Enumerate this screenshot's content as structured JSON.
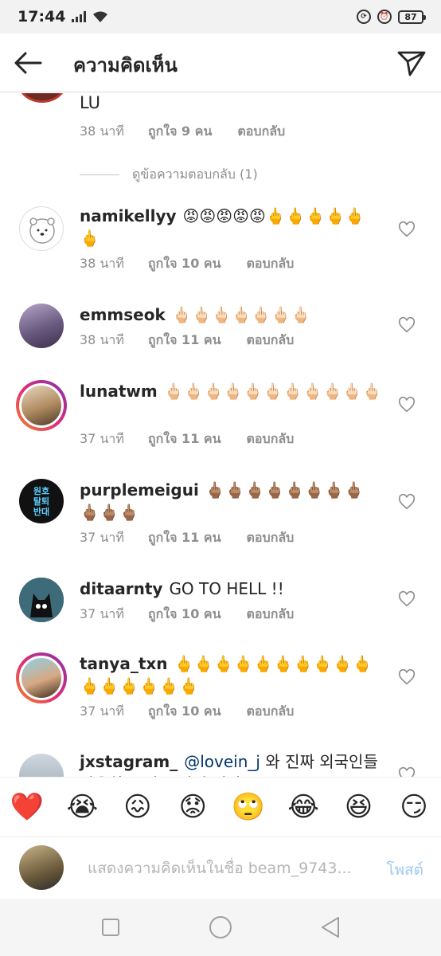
{
  "status_bar": {
    "time": "17:44",
    "battery": "87"
  },
  "header": {
    "title": "ความคิดเห็น"
  },
  "partial_comment": {
    "text": "LU",
    "time": "38 นาที",
    "likes": "ถูกใจ 9 คน",
    "reply": "ตอบกลับ"
  },
  "view_replies": "ดูข้อความตอบกลับ (1)",
  "comments": [
    {
      "username": "namikellyy",
      "text": "😡😡😡😡😡🖕🖕🖕🖕🖕🖕",
      "time": "38 นาที",
      "likes": "ถูกใจ 10 คน",
      "reply": "ตอบกลับ"
    },
    {
      "username": "emmseok",
      "text": "🖕🏻🖕🏻🖕🏻🖕🏻🖕🏻🖕🏻🖕🏻",
      "time": "38 นาที",
      "likes": "ถูกใจ 11 คน",
      "reply": "ตอบกลับ"
    },
    {
      "username": "lunatwm",
      "text": "🖕🏻🖕🏻🖕🏻🖕🏻🖕🏻🖕🏻🖕🏻🖕🏻🖕🏻🖕🏻🖕🏻",
      "time": "37 นาที",
      "likes": "ถูกใจ 11 คน",
      "reply": "ตอบกลับ"
    },
    {
      "username": "purplemeigui",
      "text": "🖕🏽🖕🏽🖕🏽🖕🏽🖕🏽🖕🏽🖕🏽🖕🏽🖕🏽🖕🏽🖕🏽",
      "time": "37 นาที",
      "likes": "ถูกใจ 11 คน",
      "reply": "ตอบกลับ",
      "avatar_text": "원호\n탈퇴\n반대"
    },
    {
      "username": "ditaarnty",
      "text": "GO TO HELL !!",
      "time": "37 นาที",
      "likes": "ถูกใจ 10 คน",
      "reply": "ตอบกลับ"
    },
    {
      "username": "tanya_txn",
      "text": "🖕🖕🖕🖕🖕🖕🖕🖕🖕🖕🖕🖕🖕🖕🖕🖕",
      "time": "37 นาที",
      "likes": "ถูกใจ 10 คน",
      "reply": "ตอบกลับ"
    },
    {
      "username": "jxstagram_",
      "mention": "@lovein_j",
      "text": "와 진짜 외국인들 반응하는 거 보면서 진짜",
      "time": "",
      "likes": "",
      "reply": ""
    }
  ],
  "emoji_bar": [
    "❤️",
    "😭",
    "😖",
    "😟",
    "🙄",
    "😂",
    "😆",
    "😏"
  ],
  "composer": {
    "placeholder": "แสดงความคิดเห็นในชื่อ beam_9743...",
    "post_label": "โพสต์"
  },
  "colors": {
    "accent_blue": "#9ec9f2",
    "meta_gray": "#8e8e8e",
    "story_ring": "#dd2a7b"
  }
}
